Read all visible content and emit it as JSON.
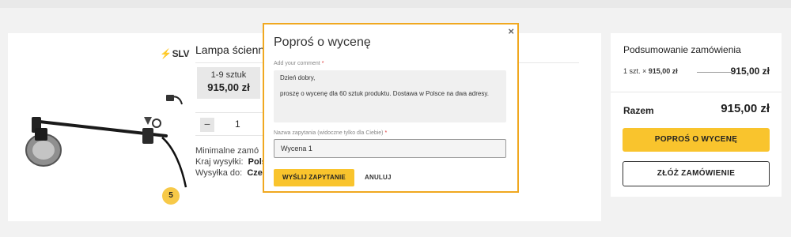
{
  "product": {
    "brand": "SLV",
    "title": "Lampa ścienn",
    "price_range": "1-9 sztuk",
    "price": "915,00 zł",
    "quantity": "1",
    "badge": "5",
    "info": {
      "min_label": "Minimalne zamó",
      "country_label": "Kraj wysyłki:",
      "country_value": "Pols",
      "ship_label": "Wysyłka do:",
      "ship_value": "Czec"
    }
  },
  "summary": {
    "title": "Podsumowanie zamówienia",
    "line_qty": "1 szt.",
    "line_price": "915,00 zł",
    "line_amount": "915,00 zł",
    "total_label": "Razem",
    "total_value": "915,00 zł",
    "quote_button": "POPROŚ O WYCENĘ",
    "order_button": "ZŁÓŻ ZAMÓWIENIE"
  },
  "modal": {
    "title": "Poproś o wycenę",
    "close": "×",
    "comment_label": "Add your comment",
    "required_mark": "*",
    "comment_line1": "Dzień dobry,",
    "comment_line2": "proszę o wycenę dla 60 sztuk produktu. Dostawa w Polsce na dwa adresy.",
    "name_label": "Nazwa zapytania (widoczne tylko dla Ciebie)",
    "name_value": "Wycena 1",
    "send_button": "WYŚLIJ ZAPYTANIE",
    "cancel_button": "ANULUJ"
  },
  "colors": {
    "accent": "#f9c42d",
    "modal_border": "#f0a820"
  }
}
